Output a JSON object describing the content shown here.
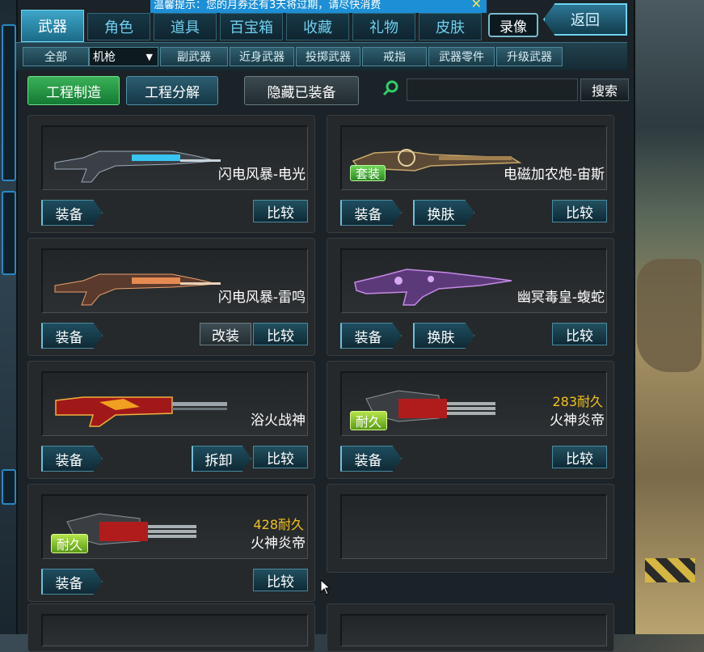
{
  "notice": {
    "text": "温馨提示：您的月券还有3天将过期，请尽快消费",
    "close": "✕"
  },
  "tabs": [
    {
      "label": "武器",
      "active": true
    },
    {
      "label": "角色"
    },
    {
      "label": "道具"
    },
    {
      "label": "百宝箱"
    },
    {
      "label": "收藏"
    },
    {
      "label": "礼物"
    },
    {
      "label": "皮肤"
    }
  ],
  "record_label": "录像",
  "back_label": "返回",
  "subcats": {
    "all": "全部",
    "selected": "机枪",
    "items": [
      "副武器",
      "近身武器",
      "投掷武器",
      "戒指",
      "武器零件",
      "升级武器"
    ]
  },
  "toolbar": {
    "craft": "工程制造",
    "disassemble": "工程分解",
    "hide_equipped": "隐藏已装备",
    "search_placeholder": "",
    "search_button": "搜索"
  },
  "cards": [
    {
      "name": "闪电风暴-电光",
      "buttons": [
        "装备"
      ],
      "compare": "比较",
      "skin": "blue"
    },
    {
      "name": "电磁加农炮-宙斯",
      "tag": "套装",
      "buttons": [
        "装备",
        "换肤"
      ],
      "compare": "比较",
      "skin": "gold"
    },
    {
      "name": "闪电风暴-雷鸣",
      "buttons": [
        "装备"
      ],
      "mod": "改装",
      "compare": "比较",
      "skin": "orange"
    },
    {
      "name": "幽冥毒皇-蝮蛇",
      "buttons": [
        "装备",
        "换肤"
      ],
      "compare": "比较",
      "skin": "purple"
    },
    {
      "name": "浴火战神",
      "buttons": [
        "装备"
      ],
      "mod": "拆卸",
      "compare": "比较",
      "skin": "red"
    },
    {
      "name": "火神炎帝",
      "durability": "283耐久",
      "tag": "耐久",
      "buttons": [
        "装备"
      ],
      "compare": "比较",
      "skin": "minigun"
    },
    {
      "name": "火神炎帝",
      "durability": "428耐久",
      "tag": "耐久",
      "buttons": [
        "装备"
      ],
      "compare": "比较",
      "skin": "minigun"
    }
  ],
  "colors": {
    "accent": "#6fd7f3",
    "durability": "#f1c21c",
    "tag_green": "#5a9b16"
  }
}
